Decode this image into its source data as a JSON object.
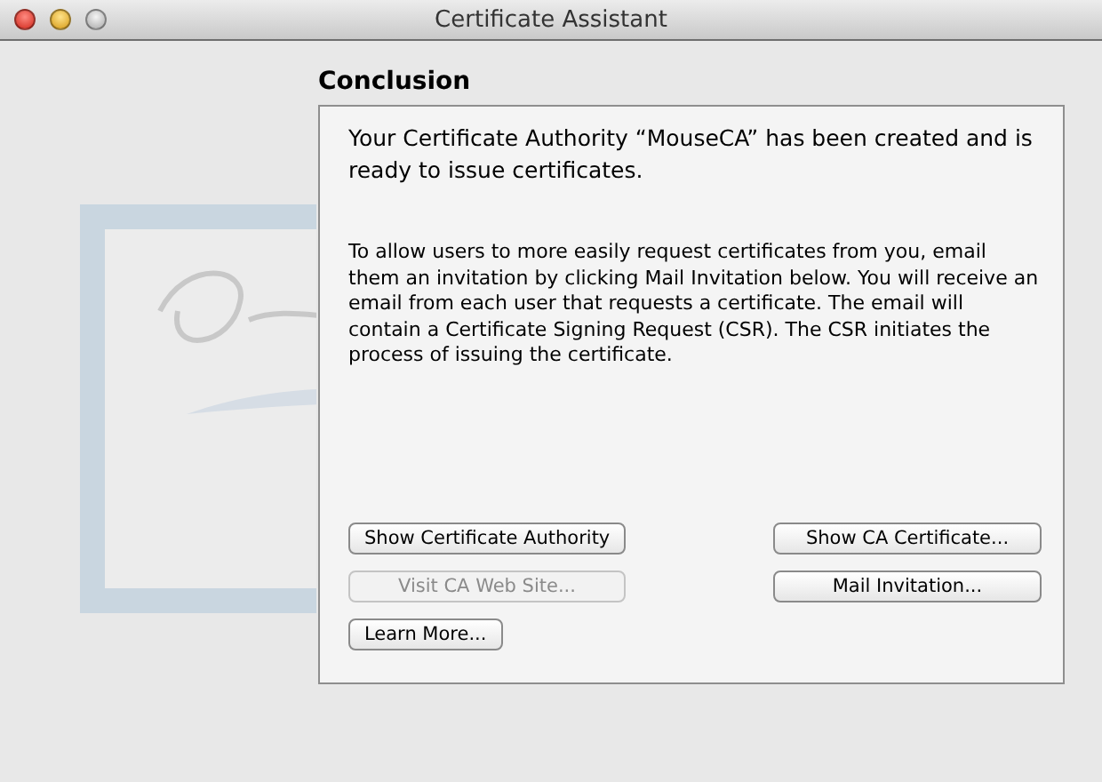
{
  "window": {
    "title": "Certificate Assistant"
  },
  "heading": "Conclusion",
  "headline": "Your Certificate Authority “MouseCA” has been created and is ready to issue certificates.",
  "body": "To allow users to more easily request certificates from you, email them an invitation by clicking Mail Invitation below. You will receive an email from each user that requests a certificate. The email will contain a Certificate Signing Request (CSR). The CSR initiates the process of issuing the certificate.",
  "left_buttons": [
    {
      "label": "Show Certificate Authority",
      "disabled": false
    },
    {
      "label": "Visit CA Web Site...",
      "disabled": true
    },
    {
      "label": "Learn More...",
      "disabled": false
    }
  ],
  "right_buttons": [
    {
      "label": "Show CA Certificate...",
      "disabled": false
    },
    {
      "label": "Mail Invitation...",
      "disabled": false
    }
  ]
}
